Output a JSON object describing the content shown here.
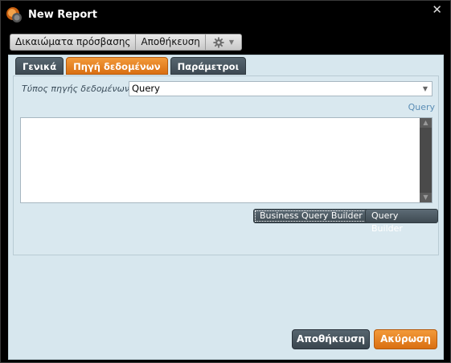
{
  "window": {
    "title": "New Report",
    "close_glyph": "✕"
  },
  "toolbar": {
    "access_rights_label": "Δικαιώματα πρόσβασης",
    "save_label": "Αποθήκευση",
    "settings_icon": "gear-icon",
    "settings_caret": "▼"
  },
  "tabs": [
    {
      "label": "Γενικά",
      "active": false
    },
    {
      "label": "Πηγή δεδομένων",
      "active": true
    },
    {
      "label": "Παράμετροι",
      "active": false
    }
  ],
  "datasource": {
    "type_label": "Τύπος πηγής δεδομένων",
    "type_value": "Query",
    "dropdown_caret": "▼",
    "query_link": "Query",
    "query_text": ""
  },
  "query_buttons": {
    "business_query_builder": "Business Query Builder",
    "query_builder": "Query Builder"
  },
  "footer": {
    "save_label": "Αποθήκευση",
    "cancel_label": "Ακύρωση"
  },
  "colors": {
    "accent_orange": "#e07a1f",
    "dark_button": "#44525b",
    "panel_bg": "#d7e7ee"
  }
}
